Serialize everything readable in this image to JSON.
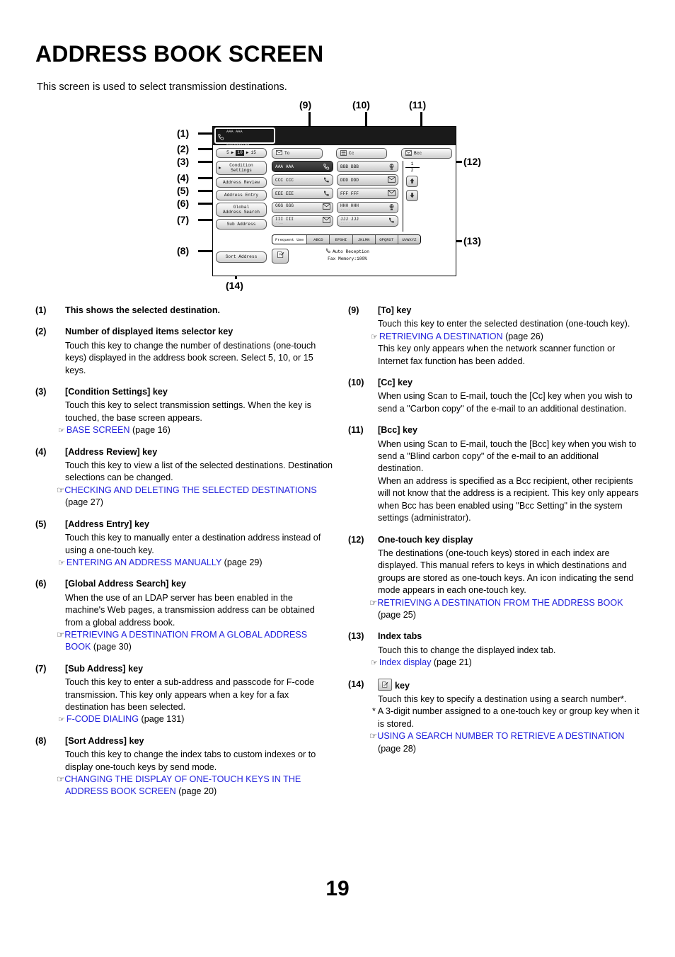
{
  "document": {
    "title": "ADDRESS BOOK SCREEN",
    "subtitle": "This screen is used to select transmission destinations.",
    "page_number": "19",
    "link_color": "#2222dd"
  },
  "figure": {
    "callouts": [
      "(1)",
      "(2)",
      "(3)",
      "(4)",
      "(5)",
      "(6)",
      "(7)",
      "(8)",
      "(9)",
      "(10)",
      "(11)",
      "(12)",
      "(13)",
      "(14)"
    ],
    "destination_display": {
      "name": "AAA AAA",
      "number": "0123456789",
      "icon": "phone-handset-icon"
    },
    "count_selector": {
      "low": "5",
      "mid": "10",
      "high": "15",
      "arrow": "▶",
      "selected": "10"
    },
    "left_keys": [
      {
        "label": "Condition\nSettings",
        "name": "condition-settings-key"
      },
      {
        "label": "Address Review",
        "name": "address-review-key"
      },
      {
        "label": "Address Entry",
        "name": "address-entry-key"
      },
      {
        "label": "Global\nAddress Search",
        "name": "global-address-search-key"
      },
      {
        "label": "Sub Address",
        "name": "sub-address-key"
      },
      {
        "label": "Sort Address",
        "name": "sort-address-key"
      }
    ],
    "send_mode_keys": [
      {
        "label": "To",
        "icon": "envelope-icon"
      },
      {
        "label": "Cc",
        "icon": "fax-envelope-icon"
      },
      {
        "label": "Bcc",
        "icon": "bcc-envelope-icon"
      }
    ],
    "one_touch_keys": [
      {
        "label": "AAA AAA",
        "icon": "phone-handset-icon",
        "selected": true,
        "sub": ""
      },
      {
        "label": "BBB BBB",
        "icon": "globe-icon",
        "selected": false,
        "sub": ""
      },
      {
        "label": "CCC CCC",
        "icon": "phone-icon",
        "selected": false,
        "sub": ""
      },
      {
        "label": "DDD DDD",
        "icon": "envelope-icon",
        "selected": false,
        "sub": ""
      },
      {
        "label": "EEE EEE",
        "icon": "phone-icon",
        "selected": false,
        "sub": ""
      },
      {
        "label": "FFF FFF",
        "icon": "envelope-icon",
        "selected": false,
        "sub": ""
      },
      {
        "label": "GGG GGG",
        "icon": "envelope-icon",
        "selected": false,
        "sub": "......."
      },
      {
        "label": "HHH HHH",
        "icon": "globe-icon",
        "selected": false,
        "sub": "....."
      },
      {
        "label": "III III",
        "icon": "envelope-icon",
        "selected": false,
        "sub": "..__"
      },
      {
        "label": "JJJ JJJ",
        "icon": "phone-icon",
        "selected": false,
        "sub": "....."
      }
    ],
    "page_indicator": {
      "current": "1",
      "total": "2"
    },
    "scroll_icons": {
      "up": "arrow-up-icon",
      "down": "arrow-down-icon"
    },
    "index_tabs": [
      {
        "label": "Frequent Use",
        "active": true
      },
      {
        "label": "ABCD",
        "active": false
      },
      {
        "label": "EFGHI",
        "active": false
      },
      {
        "label": "JKLMN",
        "active": false
      },
      {
        "label": "OPQRST",
        "active": false
      },
      {
        "label": "UVWXYZ",
        "active": false
      }
    ],
    "status": {
      "line1": "Auto Reception",
      "line2": "Fax Memory:100%",
      "icon": "phone-handset-icon"
    },
    "search_number_key_icon": "search-number-icon"
  },
  "items": {
    "i1": {
      "num": "(1)",
      "head": "This shows the selected destination."
    },
    "i2": {
      "num": "(2)",
      "head": "Number of displayed items selector key",
      "body": "Touch this key to change the number of destinations (one-touch keys) displayed in the address book screen. Select 5, 10, or 15 keys."
    },
    "i3": {
      "num": "(3)",
      "head": "[Condition Settings] key",
      "body": "Touch this key to select transmission settings. When the key is touched, the base screen appears.",
      "ref_link": "BASE SCREEN",
      "ref_page": "(page 16)"
    },
    "i4": {
      "num": "(4)",
      "head": "[Address Review] key",
      "body": "Touch this key to view a list of the selected destinations. Destination selections can be changed.",
      "ref_link": "CHECKING AND DELETING THE SELECTED DESTINATIONS",
      "ref_page": "(page 27)"
    },
    "i5": {
      "num": "(5)",
      "head": "[Address Entry] key",
      "body": "Touch this key to manually enter a destination address instead of using a one-touch key.",
      "ref_link": "ENTERING AN ADDRESS MANUALLY",
      "ref_page": "(page 29)"
    },
    "i6": {
      "num": "(6)",
      "head": "[Global Address Search] key",
      "body": "When the use of an LDAP server has been enabled in the machine's Web pages, a transmission address can be obtained from a global address book.",
      "ref_link": "RETRIEVING A DESTINATION FROM A GLOBAL ADDRESS BOOK",
      "ref_page": "(page 30)"
    },
    "i7": {
      "num": "(7)",
      "head": "[Sub Address] key",
      "body": "Touch this key to enter a sub-address and passcode for F-code transmission. This key only appears when a key for a fax destination has been selected.",
      "ref_link": "F-CODE DIALING",
      "ref_page": "(page 131)"
    },
    "i8": {
      "num": "(8)",
      "head": "[Sort Address] key",
      "body": "Touch this key to change the index tabs to custom indexes or to display one-touch keys by send mode.",
      "ref_link": "CHANGING THE DISPLAY OF ONE-TOUCH KEYS IN THE ADDRESS BOOK SCREEN",
      "ref_page": "(page 20)"
    },
    "i9": {
      "num": "(9)",
      "head": "[To] key",
      "body": "Touch this key to enter the selected destination (one-touch key).",
      "ref_link": "RETRIEVING A DESTINATION",
      "ref_page": "(page 26)",
      "body2": "This key only appears when the network scanner function or Internet fax function has been added."
    },
    "i10": {
      "num": "(10)",
      "head": "[Cc] key",
      "body": "When using Scan to E-mail, touch the [Cc] key when you wish to send a \"Carbon copy\" of the e-mail to an additional destination."
    },
    "i11": {
      "num": "(11)",
      "head": "[Bcc] key",
      "body": "When using Scan to E-mail, touch the [Bcc] key when you wish to send a \"Blind carbon copy\" of the e-mail to an additional destination.",
      "body2": "When an address is specified as a Bcc recipient, other recipients will not know that the address is a recipient. This key only appears when Bcc has been enabled using \"Bcc Setting\" in the system settings (administrator)."
    },
    "i12": {
      "num": "(12)",
      "head": "One-touch key display",
      "body": "The destinations (one-touch keys) stored in each index are displayed. This manual refers to keys in which destinations and groups are stored as one-touch keys. An icon indicating the send mode appears in each one-touch key.",
      "ref_link": "RETRIEVING A DESTINATION FROM THE ADDRESS BOOK",
      "ref_page": "(page 25)"
    },
    "i13": {
      "num": "(13)",
      "head": "Index tabs",
      "body": "Touch this to change the displayed index tab.",
      "ref_link": "Index display",
      "ref_page": "(page 21)"
    },
    "i14": {
      "num": "(14)",
      "head_suffix": "key",
      "body": "Touch this key to specify a destination using a search number*.",
      "note": "* A 3-digit number assigned to a one-touch key or group key when it is stored.",
      "ref_link": "USING A SEARCH NUMBER TO RETRIEVE A DESTINATION",
      "ref_page": "(page 28)"
    }
  }
}
